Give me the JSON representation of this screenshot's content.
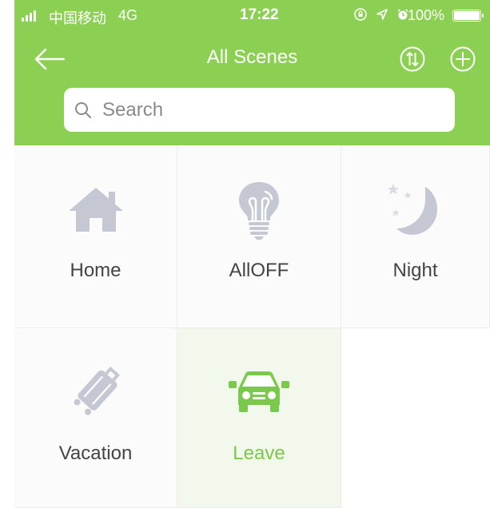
{
  "status_bar": {
    "carrier": "中国移动",
    "network": "4G",
    "time": "17:22",
    "battery": "100%"
  },
  "nav": {
    "title": "All Scenes",
    "icons": [
      "back-arrow-icon",
      "sort-icon",
      "add-icon"
    ]
  },
  "search": {
    "placeholder": "Search",
    "value": ""
  },
  "scenes": [
    {
      "label": "Home",
      "icon": "house-icon",
      "selected": false
    },
    {
      "label": "AllOFF",
      "icon": "lightbulb-icon",
      "selected": false
    },
    {
      "label": "Night",
      "icon": "moon-icon",
      "selected": false
    },
    {
      "label": "Vacation",
      "icon": "suitcase-icon",
      "selected": false
    },
    {
      "label": "Leave",
      "icon": "car-icon",
      "selected": true
    }
  ],
  "colors": {
    "brand_green": "#8bd053",
    "selected_green": "#78c84a",
    "icon_gray": "#c5c8d3"
  }
}
